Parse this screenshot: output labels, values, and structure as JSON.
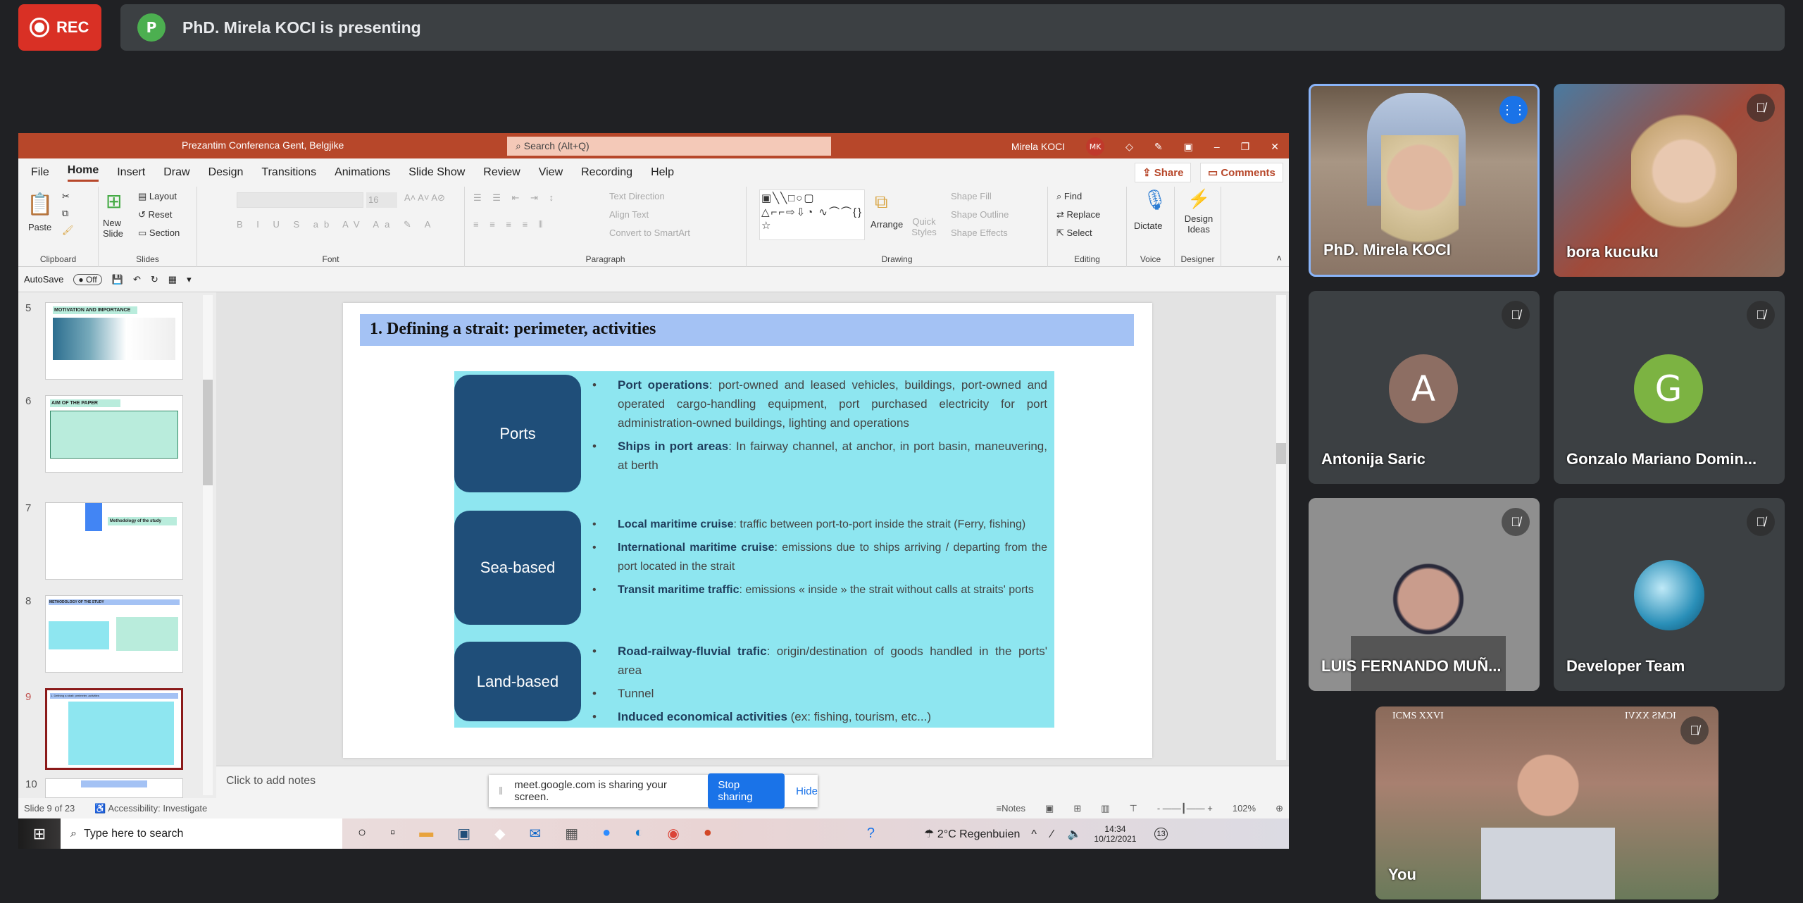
{
  "meet": {
    "rec_label": "REC",
    "presenter_initial": "P",
    "presenting_text": "PhD. Mirela KOCI is presenting",
    "share_banner": {
      "text": "meet.google.com is sharing your screen.",
      "stop": "Stop sharing",
      "hide": "Hide"
    },
    "participants": [
      {
        "name": "PhD. Mirela KOCI",
        "speaking": true
      },
      {
        "name": "bora kucuku",
        "muted": true
      },
      {
        "name": "Antonija Saric",
        "initial": "A",
        "color": "#8d6e63",
        "muted": true
      },
      {
        "name": "Gonzalo Mariano Domin...",
        "initial": "G",
        "color": "#7cb342",
        "muted": true
      },
      {
        "name": "LUIS FERNANDO MUÑ...",
        "muted": true
      },
      {
        "name": "Developer Team",
        "muted": true
      },
      {
        "name": "You",
        "muted": true,
        "banner_left": "ICMS XXVI",
        "banner_right": "ICMS XXVI"
      }
    ]
  },
  "ppt": {
    "title": "Prezantim Conferenca Gent, Belgjike",
    "search_placeholder": "Search (Alt+Q)",
    "user": "Mirela KOCI",
    "user_initials": "MK",
    "tabs": [
      "File",
      "Home",
      "Insert",
      "Draw",
      "Design",
      "Transitions",
      "Animations",
      "Slide Show",
      "Review",
      "View",
      "Recording",
      "Help"
    ],
    "share": "Share",
    "comments": "Comments",
    "ribbon": {
      "paste": "Paste",
      "new_slide": "New Slide",
      "layout": "Layout",
      "reset": "Reset",
      "section": "Section",
      "font_size": "16",
      "text_direction": "Text Direction",
      "align_text": "Align Text",
      "convert_smartart": "Convert to SmartArt",
      "arrange": "Arrange",
      "quick_styles": "Quick Styles",
      "shape_fill": "Shape Fill",
      "shape_outline": "Shape Outline",
      "shape_effects": "Shape Effects",
      "find": "Find",
      "replace": "Replace",
      "select": "Select",
      "dictate": "Dictate",
      "design_ideas": "Design Ideas",
      "groups": [
        "Clipboard",
        "Slides",
        "Font",
        "Paragraph",
        "Drawing",
        "Editing",
        "Voice",
        "Designer"
      ]
    },
    "autosave": "AutoSave",
    "autosave_state": "Off",
    "thumbnails": [
      {
        "n": "5",
        "title": "MOTIVATION AND IMPORTANCE"
      },
      {
        "n": "6",
        "title": "AIM OF THE PAPER"
      },
      {
        "n": "7",
        "title": "Methodology of the study"
      },
      {
        "n": "8",
        "title": "METHODOLOGY OF THE STUDY"
      },
      {
        "n": "9",
        "title": "1. Defining a strait: perimeter, activities"
      },
      {
        "n": "10",
        "title": ""
      }
    ],
    "slide": {
      "title": "1.   Defining a strait: perimeter, activities",
      "blocks": [
        {
          "label": "Ports",
          "items": [
            {
              "b": "Port operations",
              "t": ": port-owned and leased vehicles, buildings, port-owned and operated cargo-handling equipment, port purchased electricity for port administration-owned buildings, lighting and operations"
            },
            {
              "b": "Ships in port areas",
              "t": ": In fairway channel, at anchor, in port basin, maneuvering, at berth"
            }
          ]
        },
        {
          "label": "Sea-based",
          "items": [
            {
              "b": "Local maritime cruise",
              "t": ": traffic between port-to-port inside the strait (Ferry, fishing)"
            },
            {
              "b": "International maritime cruise",
              "t": ": emissions due to ships arriving / departing from the port located in the strait"
            },
            {
              "b": "Transit maritime traffic",
              "t": ": emissions « inside » the strait without calls at straits' ports"
            }
          ]
        },
        {
          "label": "Land-based",
          "items": [
            {
              "b": "Road-railway-fluvial trafic",
              "t": ": origin/destination of goods handled in the ports' area"
            },
            {
              "b": "",
              "t": "Tunnel"
            },
            {
              "b": "Induced economical activities",
              "t": " (ex: fishing, tourism, etc...)"
            }
          ]
        }
      ]
    },
    "notes_placeholder": "Click to add notes",
    "status": {
      "slide": "Slide 9 of 23",
      "accessibility": "Accessibility: Investigate",
      "notes": "Notes",
      "zoom": "102%"
    }
  },
  "taskbar": {
    "search": "Type here to search",
    "weather": "2°C  Regenbuien",
    "time": "14:34",
    "date": "10/12/2021",
    "notif": "13"
  }
}
